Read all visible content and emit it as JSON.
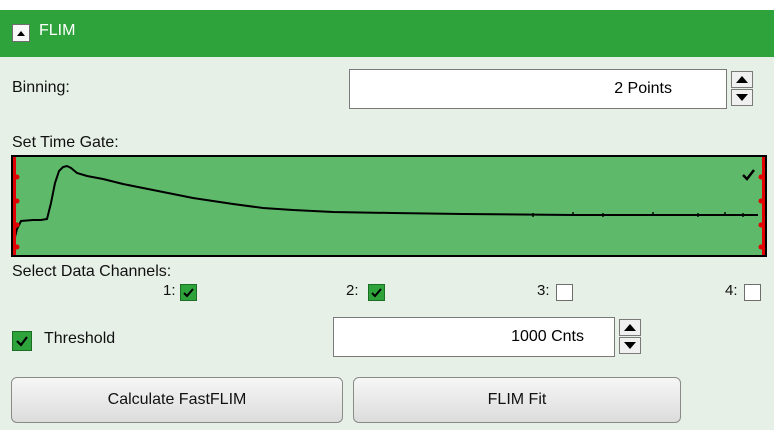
{
  "header": {
    "title": "FLIM",
    "collapse_icon": "collapse-up-icon",
    "color": "#2fa33b"
  },
  "binning": {
    "label": "Binning:",
    "value": "2 Points"
  },
  "time_gate": {
    "label": "Set Time Gate:",
    "plot_color": "#5fb96a",
    "marker_color": "#e00000",
    "check_icon": "checkmark-icon"
  },
  "channels": {
    "label": "Select Data Channels:",
    "items": [
      {
        "label": "1:",
        "checked": true
      },
      {
        "label": "2:",
        "checked": true
      },
      {
        "label": "3:",
        "checked": false
      },
      {
        "label": "4:",
        "checked": false
      }
    ]
  },
  "threshold": {
    "label": "Threshold",
    "checked": true,
    "value": "1000 Cnts"
  },
  "buttons": {
    "calculate": "Calculate FastFLIM",
    "fit": "FLIM Fit"
  }
}
